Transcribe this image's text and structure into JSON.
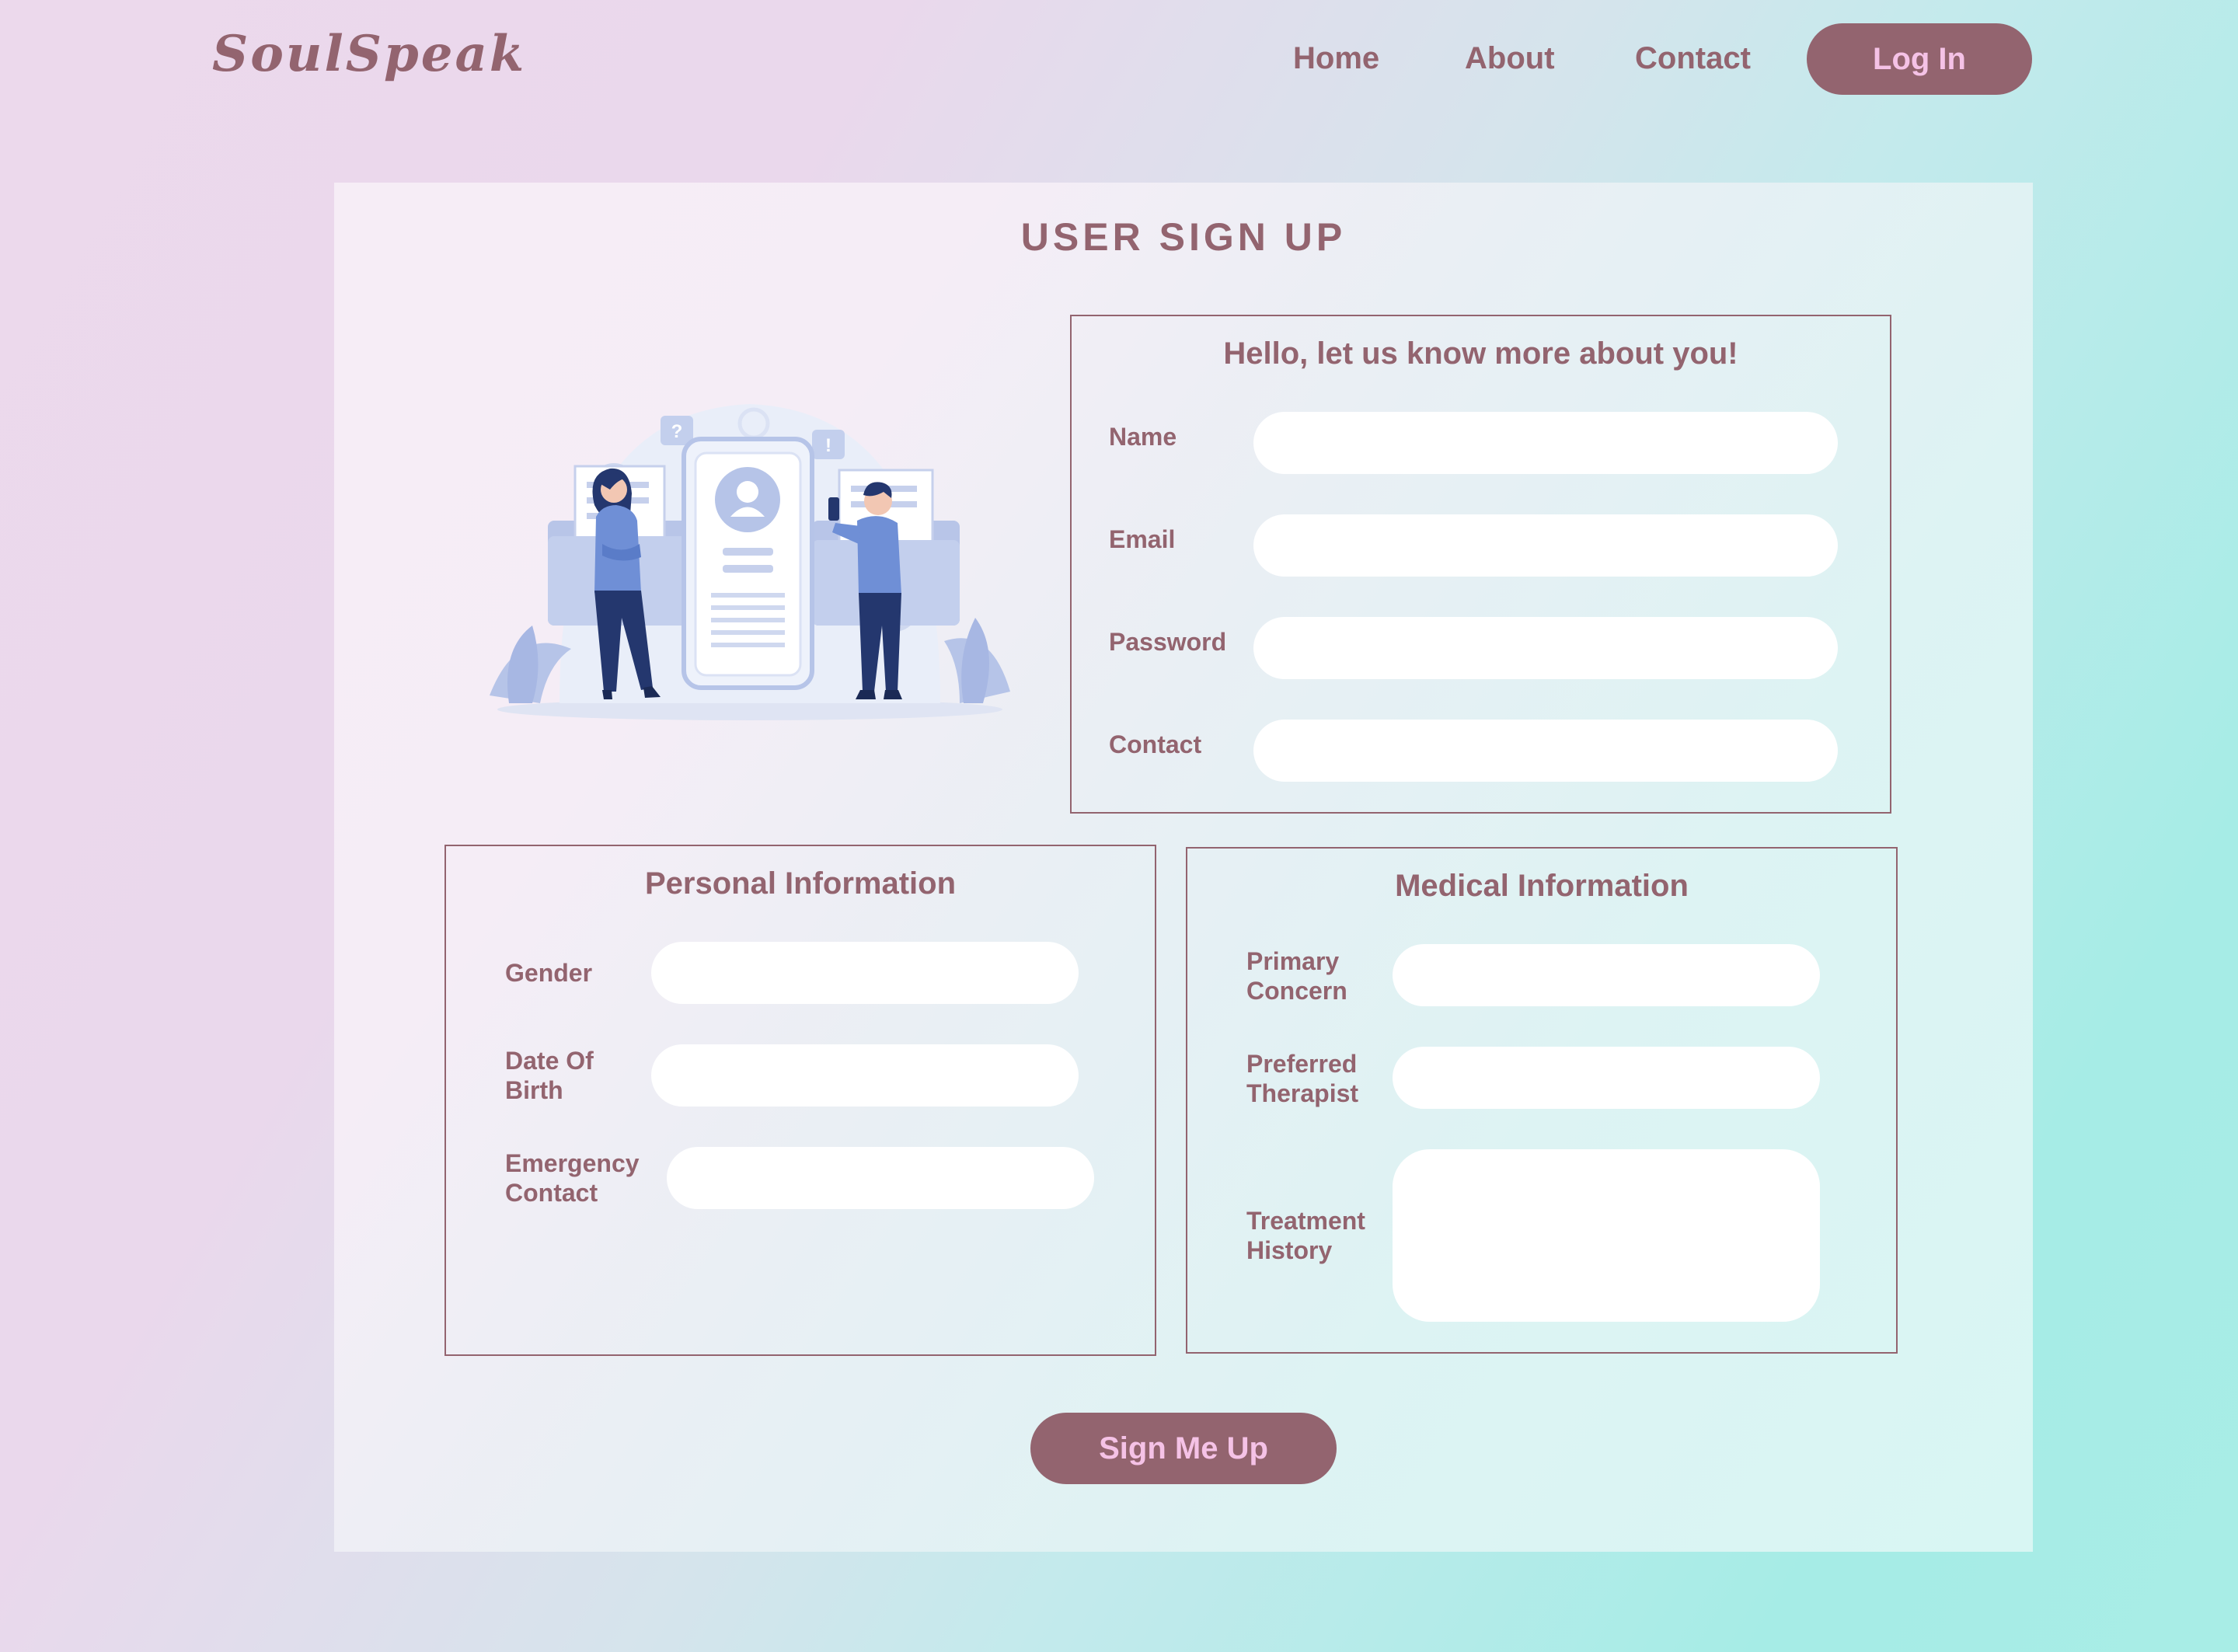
{
  "navbar": {
    "logo": "SoulSpeak",
    "links": [
      "Home",
      "About",
      "Contact"
    ],
    "login_label": "Log In"
  },
  "signup": {
    "title": "USER SIGN UP",
    "illustration_icon": "people-with-profile-card-illustration",
    "account": {
      "heading": "Hello, let us know more about you!",
      "fields": [
        {
          "label": "Name",
          "value": ""
        },
        {
          "label": "Email",
          "value": ""
        },
        {
          "label": "Password",
          "value": ""
        },
        {
          "label": "Contact",
          "value": ""
        }
      ]
    },
    "personal": {
      "heading": "Personal Information",
      "fields": [
        {
          "label_lines": [
            "Gender"
          ],
          "value": ""
        },
        {
          "label_lines": [
            "Date Of",
            "Birth"
          ],
          "value": ""
        },
        {
          "label_lines": [
            "Emergency",
            "Contact"
          ],
          "value": ""
        }
      ]
    },
    "medical": {
      "heading": "Medical Information",
      "fields": [
        {
          "label_lines": [
            "Primary",
            "Concern"
          ],
          "value": ""
        },
        {
          "label_lines": [
            "Preferred",
            "Therapist"
          ],
          "value": ""
        },
        {
          "label_lines": [
            "Treatment",
            "History"
          ],
          "value": ""
        }
      ]
    },
    "submit_label": "Sign Me Up"
  },
  "colors": {
    "brand": "#93646f",
    "button_text": "#f5c2e6",
    "input_bg": "#ffffff",
    "illustration_blue": "#6f8fd6",
    "illustration_navy": "#24376e",
    "illustration_light": "#d3dcf1"
  }
}
